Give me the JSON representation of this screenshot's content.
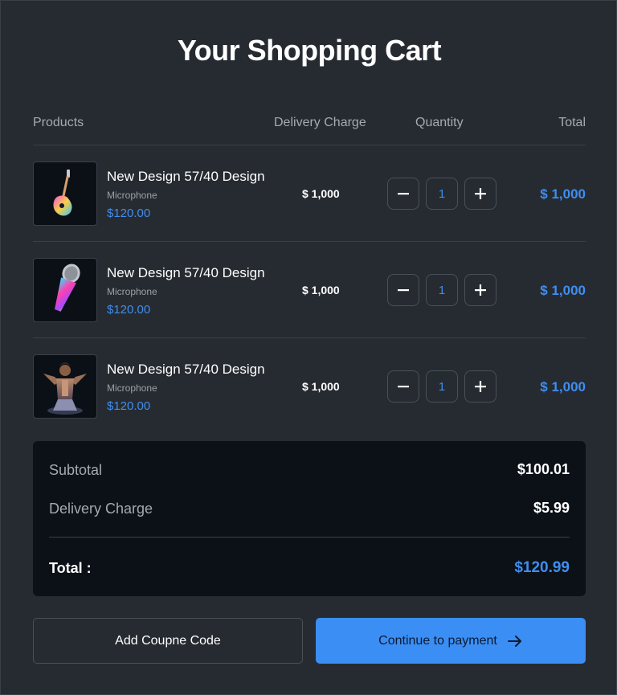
{
  "title": "Your Shopping Cart",
  "columns": {
    "products": "Products",
    "delivery": "Delivery Charge",
    "quantity": "Quantity",
    "total": "Total"
  },
  "items": [
    {
      "name": "New Design 57/40 Design",
      "category": "Microphone",
      "price": "$120.00",
      "delivery": "$ 1,000",
      "quantity": "1",
      "total": "$ 1,000",
      "image_icon": "guitar-icon"
    },
    {
      "name": "New Design 57/40 Design",
      "category": "Microphone",
      "price": "$120.00",
      "delivery": "$ 1,000",
      "quantity": "1",
      "total": "$ 1,000",
      "image_icon": "microphone-icon"
    },
    {
      "name": "New Design 57/40 Design",
      "category": "Microphone",
      "price": "$120.00",
      "delivery": "$ 1,000",
      "quantity": "1",
      "total": "$ 1,000",
      "image_icon": "performer-icon"
    }
  ],
  "summary": {
    "subtotal_label": "Subtotal",
    "subtotal_value": "$100.01",
    "delivery_label": "Delivery Charge",
    "delivery_value": "$5.99",
    "total_label": "Total :",
    "total_value": "$120.99"
  },
  "buttons": {
    "coupon": "Add Coupne Code",
    "payment": "Continue to payment"
  },
  "colors": {
    "background": "#262b31",
    "accent": "#3b8ef3",
    "summary_bg": "#0c1118"
  }
}
